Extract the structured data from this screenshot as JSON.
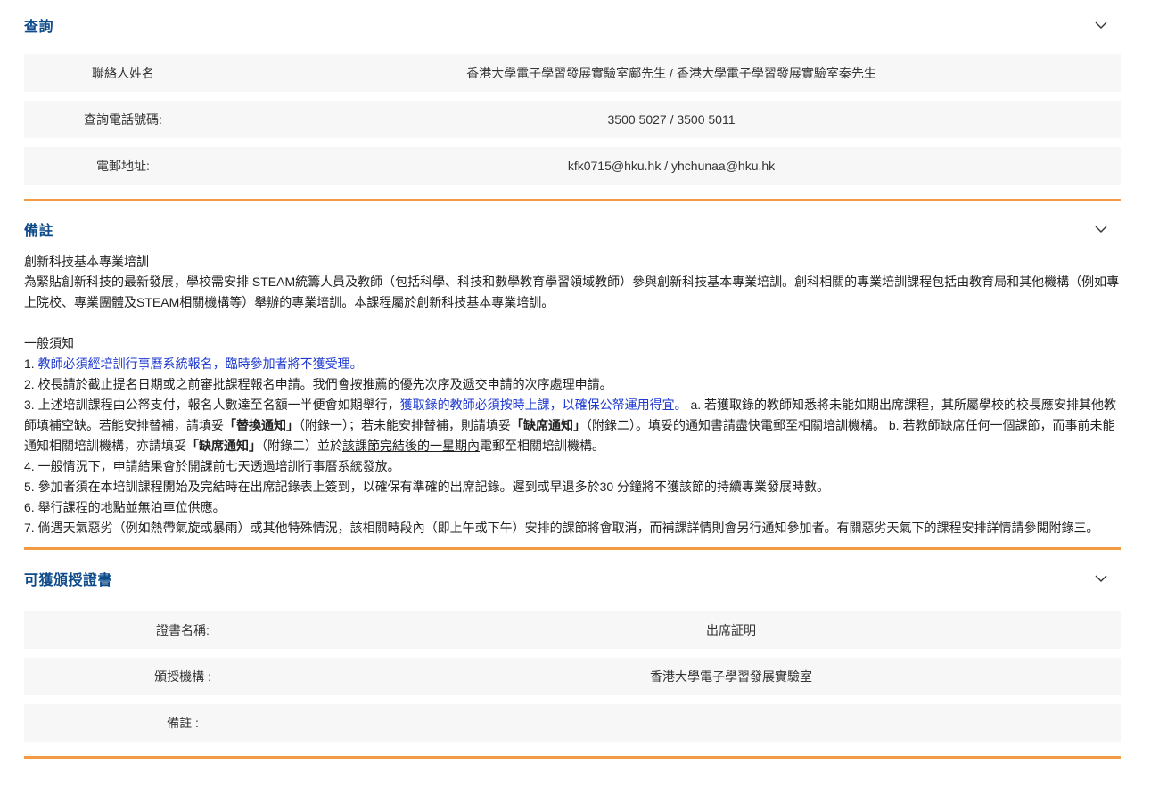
{
  "enquiry": {
    "title": "查詢",
    "rows": [
      {
        "label": "聯絡人姓名",
        "value": "香港大學電子學習發展實驗室鄺先生 / 香港大學電子學習發展實驗室秦先生"
      },
      {
        "label": "查詢電話號碼:",
        "value": "3500 5027 / 3500 5011"
      },
      {
        "label": "電郵地址:",
        "value": "kfk0715@hku.hk / yhchunaa@hku.hk"
      }
    ]
  },
  "remarks": {
    "title": "備註",
    "steam_heading": "創新科技基本專業培訓",
    "steam_body": "為緊貼創新科技的最新發展，學校需安排 STEAM統籌人員及教師（包括科學、科技和數學教育學習領域教師）參與創新科技基本專業培訓。創科相關的專業培訓課程包括由教育局和其他機構（例如專上院校、專業團體及STEAM相關機構等）舉辦的專業培訓。本課程屬於創新科技基本專業培訓。",
    "general_heading": "一般須知",
    "item1_prefix": "1. ",
    "item1_blue": "教師必須經培訓行事曆系統報名，臨時參加者將不獲受理。",
    "item2_a": "2. 校長請於",
    "item2_u": "截止提名日期或之前",
    "item2_b": "審批課程報名申請。我們會按推薦的優先次序及遞交申請的次序處理申請。",
    "item3_a": "3. 上述培訓課程由公帑支付，報名人數達至名額一半便會如期舉行，",
    "item3_blue": "獲取錄的教師必須按時上課，以確保公帑運用得宜。",
    "item3_b": " a. 若獲取錄的教師知悉將未能如期出席課程，其所屬學校的校長應安排其他教師填補空缺。若能安排替補，請填妥",
    "item3_bold1": "「替換通知」",
    "item3_c": "（附錄一）；若未能安排替補，則請填妥",
    "item3_bold2": "「缺席通知」",
    "item3_d": "（附錄二）。填妥的通知書請",
    "item3_u1": "盡快",
    "item3_e": "電郵至相關培訓機構。 b. 若教師缺席任何一個課節，而事前未能通知相關培訓機構，亦請填妥",
    "item3_bold3": "「缺席通知」",
    "item3_f": "（附錄二）並於",
    "item3_u2": "該課節完結後的一星期內",
    "item3_g": "電郵至相關培訓機構。",
    "item4_a": "4. 一般情況下，申請結果會於",
    "item4_u": "開課前七天",
    "item4_b": "透過培訓行事曆系統發放。",
    "item5": "5. 參加者須在本培訓課程開始及完結時在出席記錄表上簽到，以確保有準確的出席記錄。遲到或早退多於30 分鐘將不獲該節的持續專業發展時數。",
    "item6": "6. 舉行課程的地點並無泊車位供應。",
    "item7": "7. 倘遇天氣惡劣（例如熱帶氣旋或暴雨）或其他特殊情況，該相關時段內（即上午或下午）安排的課節將會取消，而補課詳情則會另行通知參加者。有關惡劣天氣下的課程安排詳情請參閱附錄三。"
  },
  "certificate": {
    "title": "可獲頒授證書",
    "rows": [
      {
        "label": "證書名稱:",
        "value": "出席証明"
      },
      {
        "label": "頒授機構 :",
        "value": "香港大學電子學習發展實驗室"
      },
      {
        "label": "備註 :",
        "value": ""
      }
    ]
  },
  "icons": {
    "collapse": "chevron-down-icon"
  },
  "colors": {
    "heading": "#0c4a8a",
    "divider": "#f39a45",
    "row_bg": "#f7f7f7",
    "highlight": "#1f3ad1"
  }
}
